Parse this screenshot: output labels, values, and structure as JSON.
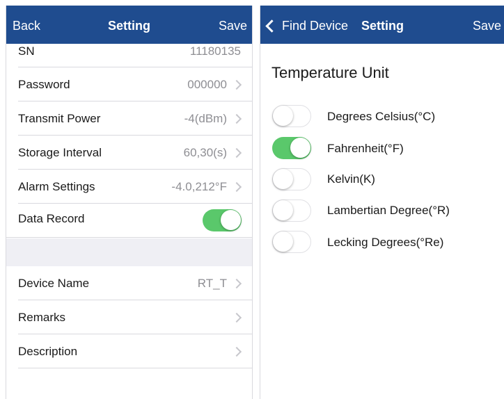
{
  "left": {
    "nav": {
      "back": "Back",
      "title": "Setting",
      "save": "Save"
    },
    "rows": [
      {
        "label": "SN",
        "value": "11180135"
      },
      {
        "label": "Password",
        "value": "000000"
      },
      {
        "label": "Transmit Power",
        "value": "-4(dBm)"
      },
      {
        "label": "Storage Interval",
        "value": "60,30(s)"
      },
      {
        "label": "Alarm Settings",
        "value": "-4.0,212°F"
      },
      {
        "label": "Data Record",
        "toggle": true
      },
      {
        "label": "Device Name",
        "value": "RT_T"
      },
      {
        "label": "Remarks",
        "value": ""
      },
      {
        "label": "Description",
        "value": ""
      }
    ]
  },
  "right": {
    "nav": {
      "back": "Find Device",
      "title": "Setting",
      "save": "Save"
    },
    "section_title": "Temperature Unit",
    "options": [
      {
        "label": "Degrees Celsius(°C)",
        "on": false
      },
      {
        "label": "Fahrenheit(°F)",
        "on": true
      },
      {
        "label": "Kelvin(K)",
        "on": false
      },
      {
        "label": "Lambertian Degree(°R)",
        "on": false
      },
      {
        "label": "Lecking Degrees(°Re)",
        "on": false
      }
    ]
  },
  "colors": {
    "nav_bg": "#1f4c8f",
    "toggle_on": "#5ac86b",
    "group_bg": "#efeff4"
  }
}
